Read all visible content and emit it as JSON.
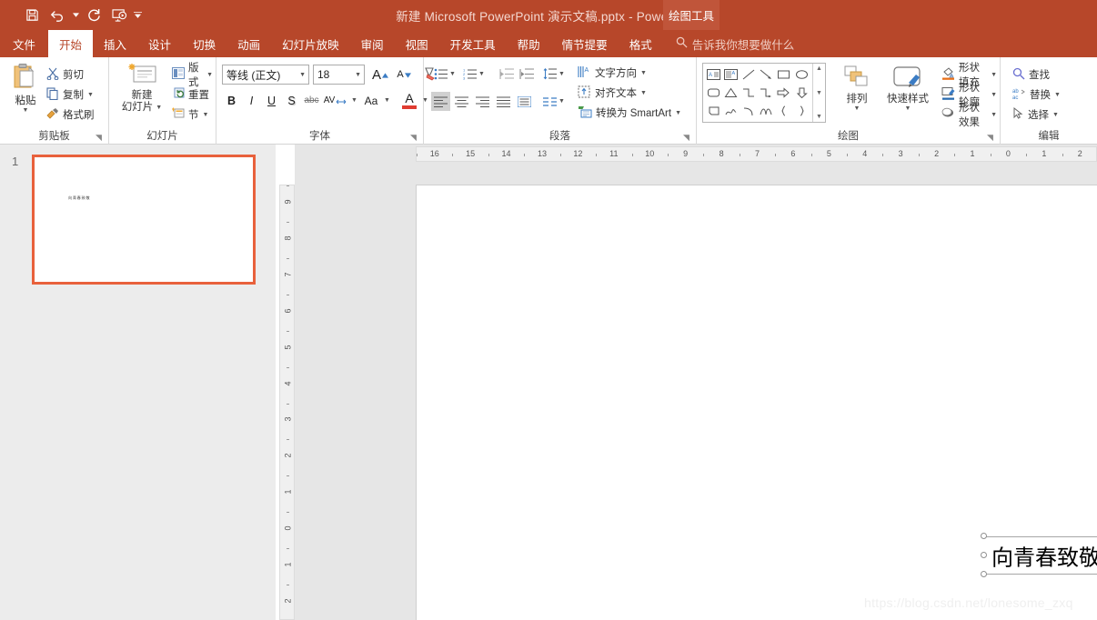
{
  "titlebar": {
    "document_title": "新建 Microsoft PowerPoint 演示文稿.pptx  -  PowerPoint",
    "contextual_group": "绘图工具",
    "qat": [
      {
        "name": "save",
        "label": "保存"
      },
      {
        "name": "undo",
        "label": "撤消"
      },
      {
        "name": "redo",
        "label": "恢复"
      },
      {
        "name": "start-slideshow",
        "label": "从头开始"
      },
      {
        "name": "customize-qat",
        "label": "自定义快速访问工具栏"
      }
    ]
  },
  "tabs": [
    {
      "label": "文件",
      "active": false
    },
    {
      "label": "开始",
      "active": true
    },
    {
      "label": "插入",
      "active": false
    },
    {
      "label": "设计",
      "active": false
    },
    {
      "label": "切换",
      "active": false
    },
    {
      "label": "动画",
      "active": false
    },
    {
      "label": "幻灯片放映",
      "active": false
    },
    {
      "label": "审阅",
      "active": false
    },
    {
      "label": "视图",
      "active": false
    },
    {
      "label": "开发工具",
      "active": false
    },
    {
      "label": "帮助",
      "active": false
    },
    {
      "label": "情节提要",
      "active": false
    },
    {
      "label": "格式",
      "active": false,
      "contextual": true
    }
  ],
  "tellme": {
    "placeholder": "告诉我你想要做什么",
    "icon": "search-icon"
  },
  "ribbon": {
    "clipboard": {
      "group_label": "剪贴板",
      "paste": "粘贴",
      "cut": "剪切",
      "copy": "复制",
      "format_painter": "格式刷"
    },
    "slides": {
      "group_label": "幻灯片",
      "new_slide_line1": "新建",
      "new_slide_line2": "幻灯片",
      "layout": "版式",
      "reset": "重置",
      "section": "节"
    },
    "font": {
      "group_label": "字体",
      "font_name": "等线 (正文)",
      "font_size": "18",
      "grow_font": "A",
      "shrink_font": "A",
      "clear_formatting": "清除所有格式",
      "bold": "B",
      "italic": "I",
      "underline": "U",
      "shadow": "S",
      "strikethrough": "abc",
      "char_spacing": "AV",
      "change_case": "Aa",
      "font_color": "A"
    },
    "paragraph": {
      "group_label": "段落",
      "text_direction": "文字方向",
      "align_text": "对齐文本",
      "convert_smartart": "转换为 SmartArt"
    },
    "drawing": {
      "group_label": "绘图",
      "arrange": "排列",
      "quick_styles_line1": "快速样式",
      "shape_fill": "形状填充",
      "shape_outline": "形状轮廓",
      "shape_effects": "形状效果"
    },
    "editing": {
      "group_label": "编辑",
      "find": "查找",
      "replace": "替换",
      "select": "选择"
    }
  },
  "thumbnails": {
    "slides": [
      {
        "number": "1",
        "text": "向青春致敬",
        "selected": true
      }
    ]
  },
  "rulers": {
    "horizontal": [
      "16",
      "15",
      "14",
      "13",
      "12",
      "11",
      "10",
      "9",
      "8",
      "7",
      "6",
      "5",
      "4",
      "3",
      "2",
      "1",
      "0",
      "1",
      "2"
    ],
    "vertical": [
      "9",
      "8",
      "7",
      "6",
      "5",
      "4",
      "3",
      "2",
      "1",
      "0",
      "1",
      "2"
    ]
  },
  "slide": {
    "textbox": {
      "text": "向青春致敬",
      "selected": true
    }
  },
  "watermark": "https://blog.csdn.net/lonesome_zxq",
  "colors": {
    "accent": "#b7472a",
    "contextual": "#c0553a",
    "thumb_select": "#e8613c",
    "canvas_bg": "#e6e6e6",
    "pane_bg": "#ececec"
  }
}
